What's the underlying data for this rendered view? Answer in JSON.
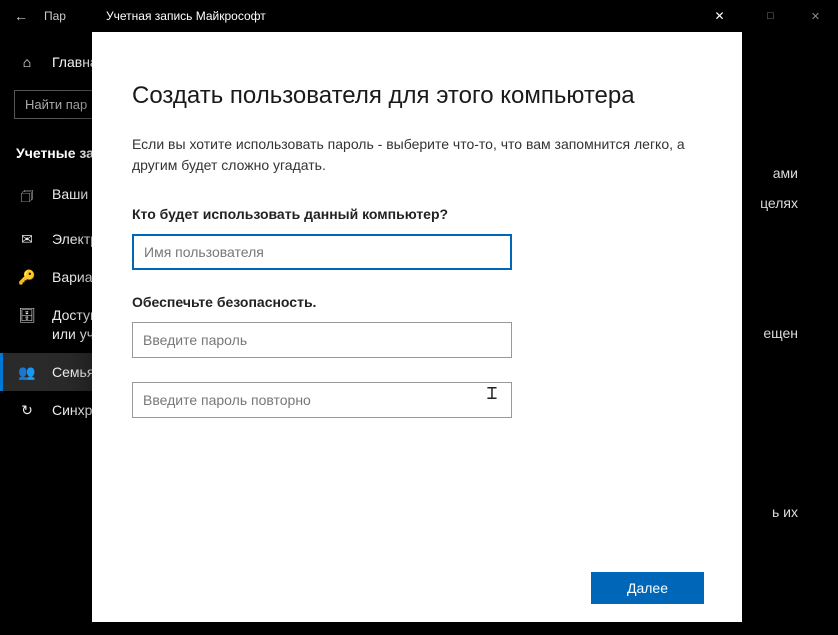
{
  "settings": {
    "titlebar": "Пар",
    "win_minimize": "―",
    "win_maximize": "□",
    "win_close": "✕",
    "home_label": "Главна",
    "search_placeholder": "Найти пар",
    "section_heading": "Учетные за",
    "nav": [
      {
        "icon": "user-card-icon",
        "glyph": "🗇",
        "label": "Ваши д"
      },
      {
        "icon": "mail-icon",
        "glyph": "✉",
        "label": "Электр"
      },
      {
        "icon": "key-icon",
        "glyph": "🔑",
        "label": "Вариан"
      },
      {
        "icon": "work-icon",
        "glyph": "🗄",
        "label": "Доступ\nили уч"
      },
      {
        "icon": "family-icon",
        "glyph": "👥",
        "label": "Семья"
      },
      {
        "icon": "sync-icon",
        "glyph": "↻",
        "label": "Синхро"
      }
    ],
    "active_index": 4,
    "content_fragments": [
      "ами",
      "целях",
      "ещен",
      "ь их"
    ]
  },
  "dialog": {
    "title": "Учетная запись Майкрософт",
    "close_glyph": "✕",
    "heading": "Создать пользователя для этого компьютера",
    "description": "Если вы хотите использовать пароль - выберите что-то, что вам запомнится легко, а другим будет сложно угадать.",
    "q1_label": "Кто будет использовать данный компьютер?",
    "username_placeholder": "Имя пользователя",
    "q2_label": "Обеспечьте безопасность.",
    "password_placeholder": "Введите пароль",
    "password2_placeholder": "Введите пароль повторно",
    "next_button": "Далее"
  }
}
